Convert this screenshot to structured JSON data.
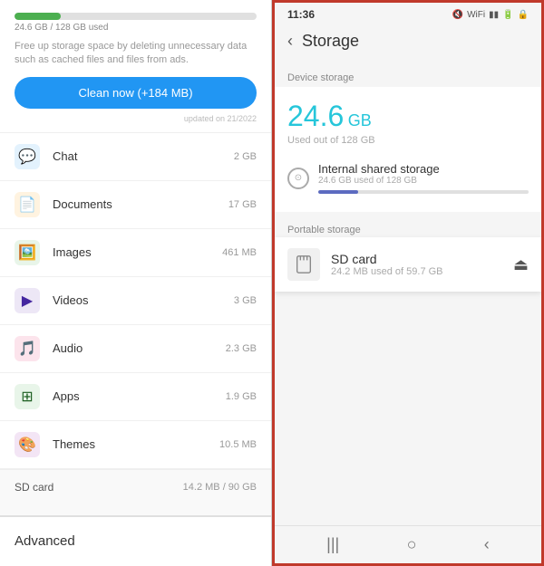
{
  "left": {
    "used_bar_width": "19%",
    "used_text": "24.6 GB / 128 GB used",
    "clean_description": "Free up storage space by deleting unnecessary data such as cached files and files from ads.",
    "clean_button_label": "Clean now (+184 MB)",
    "updated_text": "updated on 21/2022",
    "storage_items": [
      {
        "id": "chat",
        "label": "Chat",
        "size": "2 GB",
        "icon": "💬",
        "icon_class": "icon-chat"
      },
      {
        "id": "docs",
        "label": "Documents",
        "size": "17 GB",
        "icon": "📄",
        "icon_class": "icon-docs"
      },
      {
        "id": "images",
        "label": "Images",
        "size": "461 MB",
        "icon": "🖼️",
        "icon_class": "icon-images"
      },
      {
        "id": "videos",
        "label": "Videos",
        "size": "3 GB",
        "icon": "▶",
        "icon_class": "icon-videos"
      },
      {
        "id": "audio",
        "label": "Audio",
        "size": "2.3 GB",
        "icon": "🎵",
        "icon_class": "icon-audio"
      },
      {
        "id": "apps",
        "label": "Apps",
        "size": "1.9 GB",
        "icon": "⚙",
        "icon_class": "icon-apps"
      },
      {
        "id": "themes",
        "label": "Themes",
        "size": "10.5 MB",
        "icon": "🎨",
        "icon_class": "icon-themes"
      }
    ],
    "sdcard_label": "SD card",
    "sdcard_size": "14.2 MB / 90 GB",
    "advanced_label": "Advanced"
  },
  "right": {
    "status_time": "11:36",
    "status_icons": "◀ ◀ ▮▮ ⬛ 🔒",
    "back_arrow": "‹",
    "page_title": "Storage",
    "device_storage_section": "Device storage",
    "storage_gb": "24.6",
    "storage_unit": "GB",
    "used_out_of": "Used out of 128 GB",
    "internal_name": "Internal shared storage",
    "internal_used": "24.6 GB used of 128 GB",
    "internal_bar_pct": "19%",
    "portable_section": "Portable storage",
    "sd_name": "SD card",
    "sd_used": "24.2 MB used of 59.7 GB",
    "nav_left": "|||",
    "nav_center": "○",
    "nav_right": "‹"
  }
}
